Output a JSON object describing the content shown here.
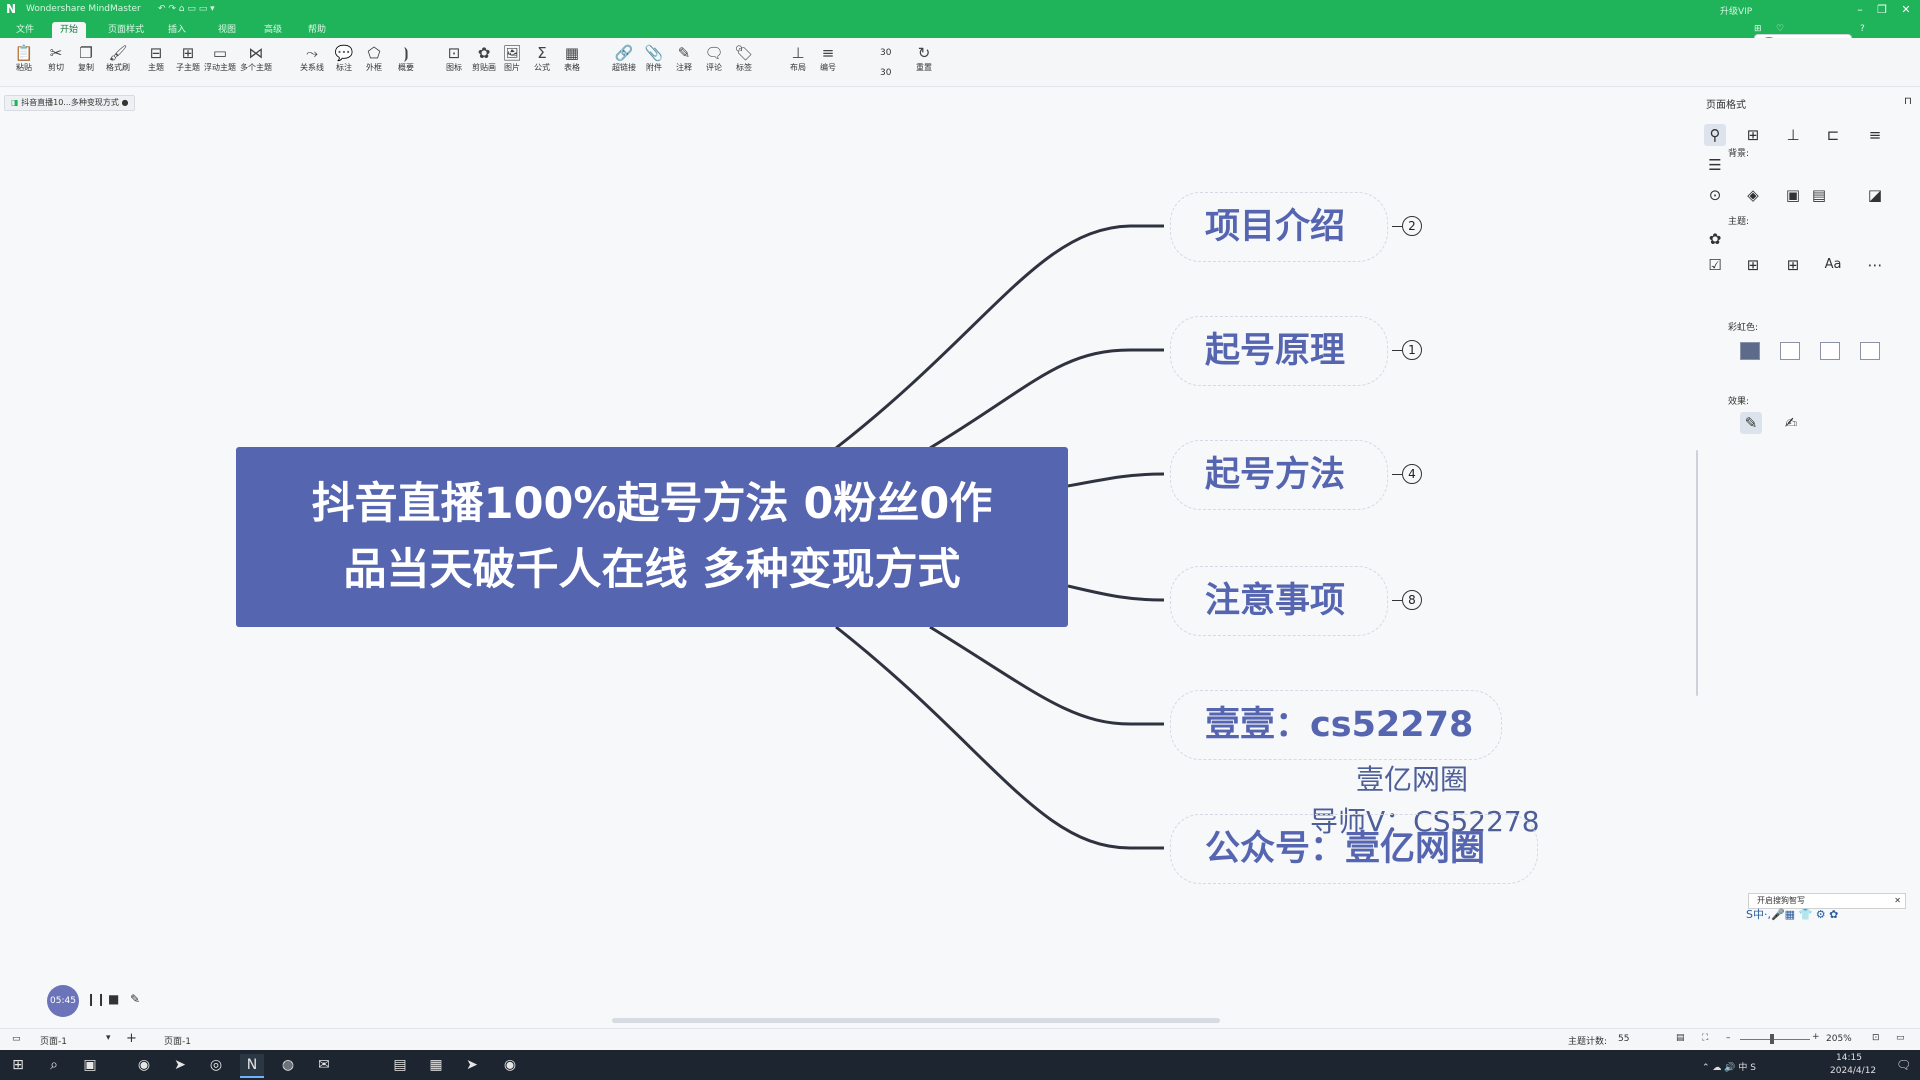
{
  "titlebar": {
    "app_title": "Wondershare MindMaster",
    "quick_actions": "↶ ↷ ⌂ ▭ ▭ ▾",
    "right_items": [
      "升级VIP",
      "⊞",
      "♡",
      "?"
    ],
    "window": {
      "min": "–",
      "max": "❐",
      "close": "✕"
    }
  },
  "menu": {
    "tabs": [
      "文件",
      "开始",
      "页面样式",
      "插入",
      "视图",
      "高级",
      "帮助"
    ],
    "active_tab": "开始"
  },
  "share": {
    "user": "我的",
    "upload": "上传"
  },
  "toolbar": {
    "items": [
      {
        "icon": "📋",
        "label": "粘贴"
      },
      {
        "icon": "✂",
        "label": "剪切"
      },
      {
        "icon": "❐",
        "label": "复制"
      },
      {
        "icon": "🖌",
        "label": "格式刷"
      },
      {
        "icon": "⊟",
        "label": "主题"
      },
      {
        "icon": "⊞",
        "label": "子主题"
      },
      {
        "icon": "▭",
        "label": "浮动主题"
      },
      {
        "icon": "⋈",
        "label": "多个主题"
      },
      {
        "icon": "⤳",
        "label": "关系线"
      },
      {
        "icon": "💬",
        "label": "标注"
      },
      {
        "icon": "⬠",
        "label": "外框"
      },
      {
        "icon": "⦘",
        "label": "概要"
      },
      {
        "icon": "⊡",
        "label": "图标"
      },
      {
        "icon": "✿",
        "label": "剪贴画"
      },
      {
        "icon": "🖼",
        "label": "图片"
      },
      {
        "icon": "Σ",
        "label": "公式"
      },
      {
        "icon": "▦",
        "label": "表格"
      },
      {
        "icon": "🔗",
        "label": "超链接"
      },
      {
        "icon": "📎",
        "label": "附件"
      },
      {
        "icon": "✎",
        "label": "注释"
      },
      {
        "icon": "🗨",
        "label": "评论"
      },
      {
        "icon": "🏷",
        "label": "标签"
      },
      {
        "icon": "⊥",
        "label": "布局"
      },
      {
        "icon": "≡",
        "label": "编号"
      },
      {
        "icon": "↻",
        "label": "重置"
      }
    ],
    "spacing_values": [
      "30",
      "30"
    ]
  },
  "document_tab": "抖音直播10...多种变现方式",
  "mindmap": {
    "central_topic": [
      "抖音直播100%起号方法 0粉丝0作",
      "品当天破千人在线 多种变现方式"
    ],
    "branches": [
      {
        "label": "项目介绍",
        "count": "2"
      },
      {
        "label": "起号原理",
        "count": "1"
      },
      {
        "label": "起号方法",
        "count": "4"
      },
      {
        "label": "注意事项",
        "count": "8"
      },
      {
        "label": "壹壹：cs52278",
        "count": ""
      },
      {
        "label": "公众号：壹亿网圈",
        "count": ""
      }
    ],
    "watermark": [
      "壹亿网圈",
      "导师V：CS52278"
    ],
    "colors": {
      "central": "#5565b0",
      "branch_text": "#5565b0",
      "line": "#2f3340"
    }
  },
  "right_panel": {
    "title": "页面格式",
    "background_label": "背景:",
    "theme_label": "主题:",
    "rainbow_label": "彩虹色:",
    "effect_label": "效果:",
    "theme_font": "Aa"
  },
  "recorder": {
    "time": "05:45"
  },
  "statusbar": {
    "page": "页面-1",
    "page_tab": "页面-1",
    "topic_count_label": "主题计数:",
    "topic_count": "55",
    "zoom": "205%"
  },
  "ime": {
    "notice": "开启搜狗智写",
    "text": "S中·,🎤▦ 👕 ⚙ ✿"
  },
  "taskbar": {
    "time": "14:15",
    "date": "2024/4/12",
    "lang": "中",
    "tray": "⌃ ☁ 🔊 中 S"
  }
}
